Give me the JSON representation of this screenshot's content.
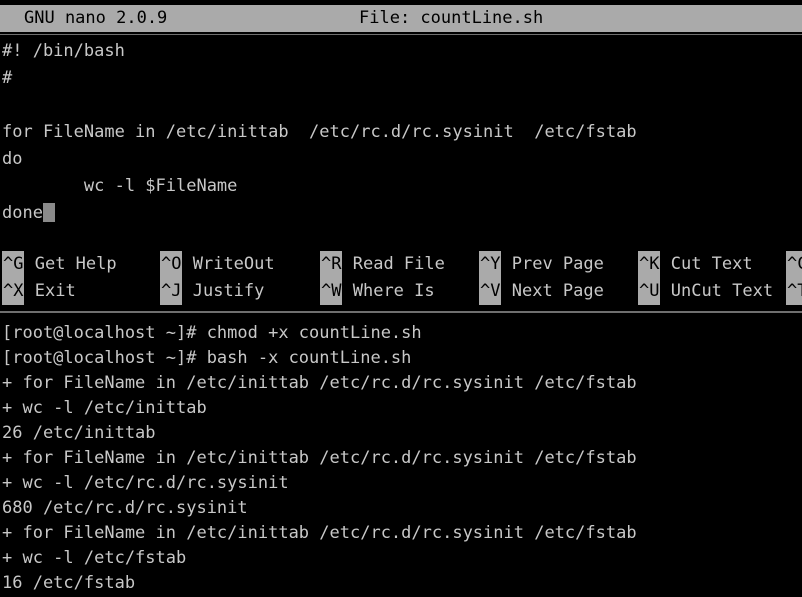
{
  "nano": {
    "titlebar": {
      "app": "GNU nano 2.0.9",
      "file": "File: countLine.sh"
    },
    "buffer_lines": [
      "#! /bin/bash",
      "#",
      "",
      "for FileName in /etc/inittab  /etc/rc.d/rc.sysinit  /etc/fstab",
      "do",
      "        wc -l $FileName",
      "done"
    ],
    "cursor": {
      "line_index": 6,
      "column": 4
    },
    "shortcuts_row1": [
      {
        "key": "^G",
        "label": "Get Help"
      },
      {
        "key": "^O",
        "label": "WriteOut"
      },
      {
        "key": "^R",
        "label": "Read File"
      },
      {
        "key": "^Y",
        "label": "Prev Page"
      },
      {
        "key": "^K",
        "label": "Cut Text"
      },
      {
        "key": "^C",
        "label": ""
      }
    ],
    "shortcuts_row2": [
      {
        "key": "^X",
        "label": "Exit"
      },
      {
        "key": "^J",
        "label": "Justify"
      },
      {
        "key": "^W",
        "label": "Where Is"
      },
      {
        "key": "^V",
        "label": "Next Page"
      },
      {
        "key": "^U",
        "label": "UnCut Text"
      },
      {
        "key": "^T",
        "label": ""
      }
    ]
  },
  "shell": {
    "lines": [
      "[root@localhost ~]# chmod +x countLine.sh",
      "[root@localhost ~]# bash -x countLine.sh",
      "+ for FileName in /etc/inittab /etc/rc.d/rc.sysinit /etc/fstab",
      "+ wc -l /etc/inittab",
      "26 /etc/inittab",
      "+ for FileName in /etc/inittab /etc/rc.d/rc.sysinit /etc/fstab",
      "+ wc -l /etc/rc.d/rc.sysinit",
      "680 /etc/rc.d/rc.sysinit",
      "+ for FileName in /etc/inittab /etc/rc.d/rc.sysinit /etc/fstab",
      "+ wc -l /etc/fstab",
      "16 /etc/fstab"
    ]
  },
  "colors": {
    "background": "#000000",
    "foreground": "#c8c8c8",
    "highlight_bg": "#aaaaaa",
    "highlight_fg": "#000000",
    "cursor": "#8a8a8a",
    "divider": "#6f6f6f"
  }
}
